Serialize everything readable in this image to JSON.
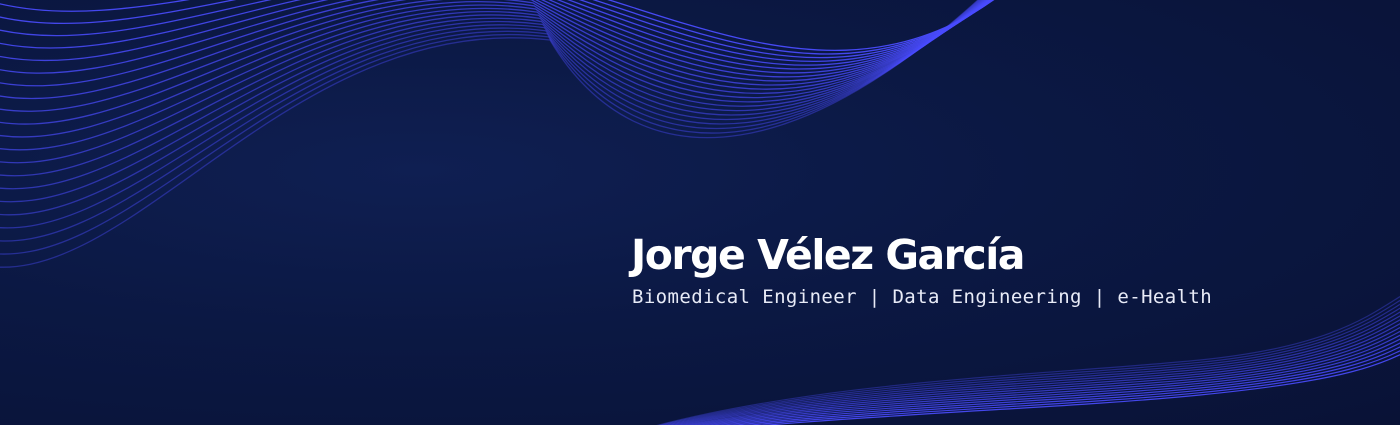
{
  "banner": {
    "name": "Jorge Vélez García",
    "tagline": "Biomedical Engineer | Data Engineering | e-Health"
  },
  "colors": {
    "background": "#0b1843",
    "wave_line": "#4a4cff",
    "name_text": "#ffffff",
    "tagline_text": "#e8ebf7"
  },
  "decoration": {
    "top_wave": "flowing-lines-pattern",
    "bottom_wave": "flowing-lines-pattern"
  }
}
